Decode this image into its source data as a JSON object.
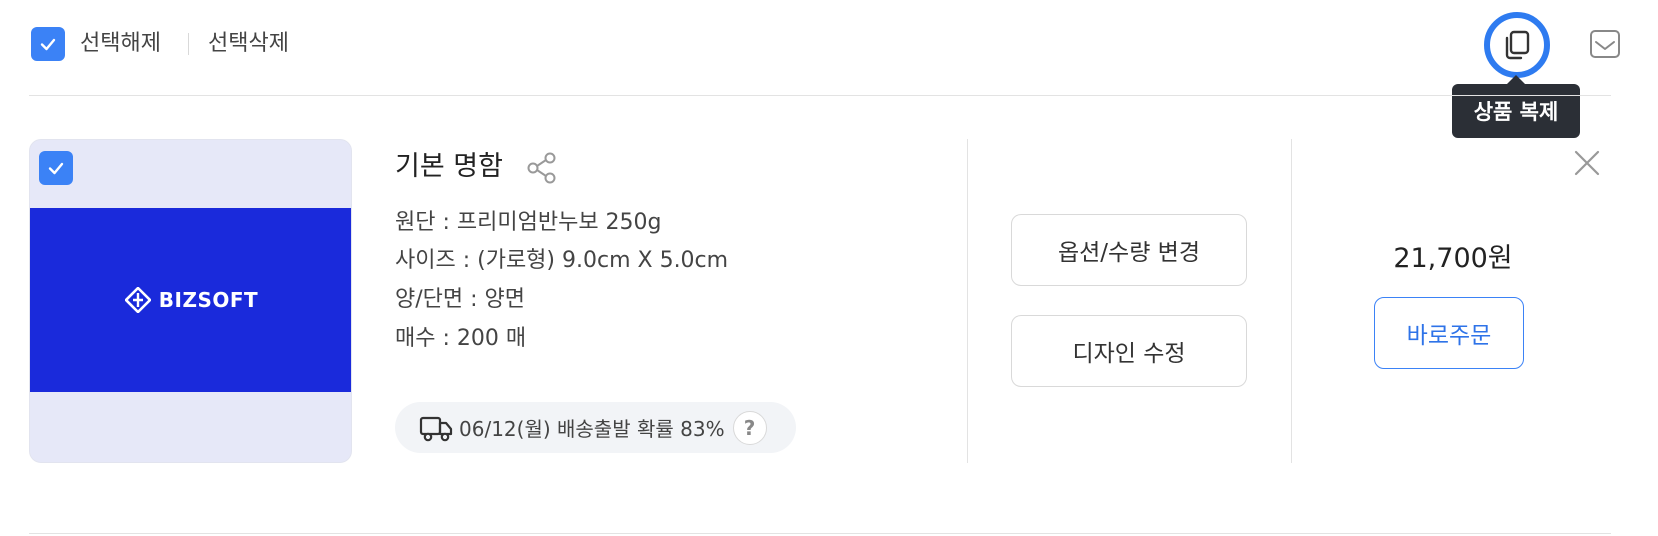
{
  "toolbar": {
    "deselect_label": "선택해제",
    "delete_label": "선택삭제",
    "copy_tooltip": "상품 복제"
  },
  "item": {
    "thumbnail_brand": "BIZSOFT",
    "title": "기본 명함",
    "specs": [
      "원단 : 프리미엄반누보 250g",
      "사이즈 : (가로형) 9.0cm X 5.0cm",
      "양/단면 : 양면",
      "매수 : 200 매"
    ],
    "shipping_text": "06/12(월) 배송출발 확률 83%",
    "help_label": "?",
    "option_button": "옵션/수량 변경",
    "design_button": "디자인 수정",
    "price": "21,700원",
    "order_button": "바로주문"
  },
  "colors": {
    "accent": "#3b82f6",
    "thumbnail_card": "#1a2adb",
    "tooltip_bg": "#2b2f36"
  },
  "icons": {
    "checkbox": "check-icon",
    "copy": "copy-icon",
    "save": "inbox-icon",
    "share": "share-icon",
    "truck": "truck-icon",
    "close": "close-icon"
  }
}
